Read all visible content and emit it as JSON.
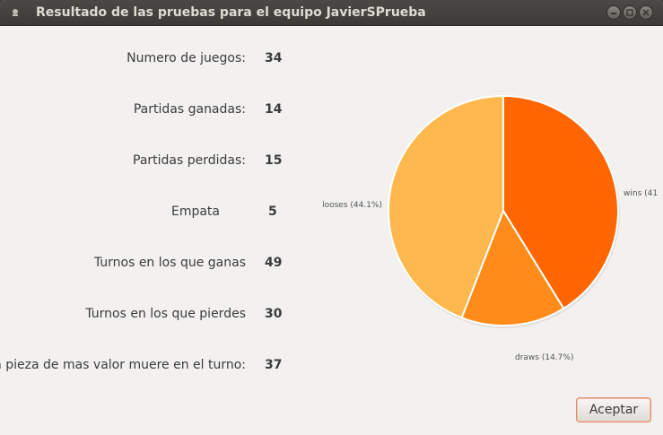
{
  "window": {
    "title": "Resultado de las pruebas para el equipo JavierSPrueba"
  },
  "stats": [
    {
      "label": "Numero de juegos:",
      "value": "34"
    },
    {
      "label": "Partidas ganadas:",
      "value": "14"
    },
    {
      "label": "Partidas perdidas:",
      "value": "15"
    },
    {
      "label": "Empata",
      "value": "5"
    },
    {
      "label": "Turnos en los que ganas",
      "value": "49"
    },
    {
      "label": "Turnos en los que pierdes",
      "value": "30"
    },
    {
      "label": "La pieza de mas valor muere en el turno:",
      "value": "37"
    }
  ],
  "chart_data": {
    "type": "pie",
    "categories": [
      "wins",
      "draws",
      "looses"
    ],
    "values": [
      41.2,
      14.7,
      44.1
    ],
    "labels": [
      "wins (41",
      "draws (14.7%)",
      "looses (44.1%)"
    ],
    "colors": [
      "#ff6600",
      "#ff8c1a",
      "#ffb84d"
    ]
  },
  "buttons": {
    "accept_label": "Aceptar"
  }
}
